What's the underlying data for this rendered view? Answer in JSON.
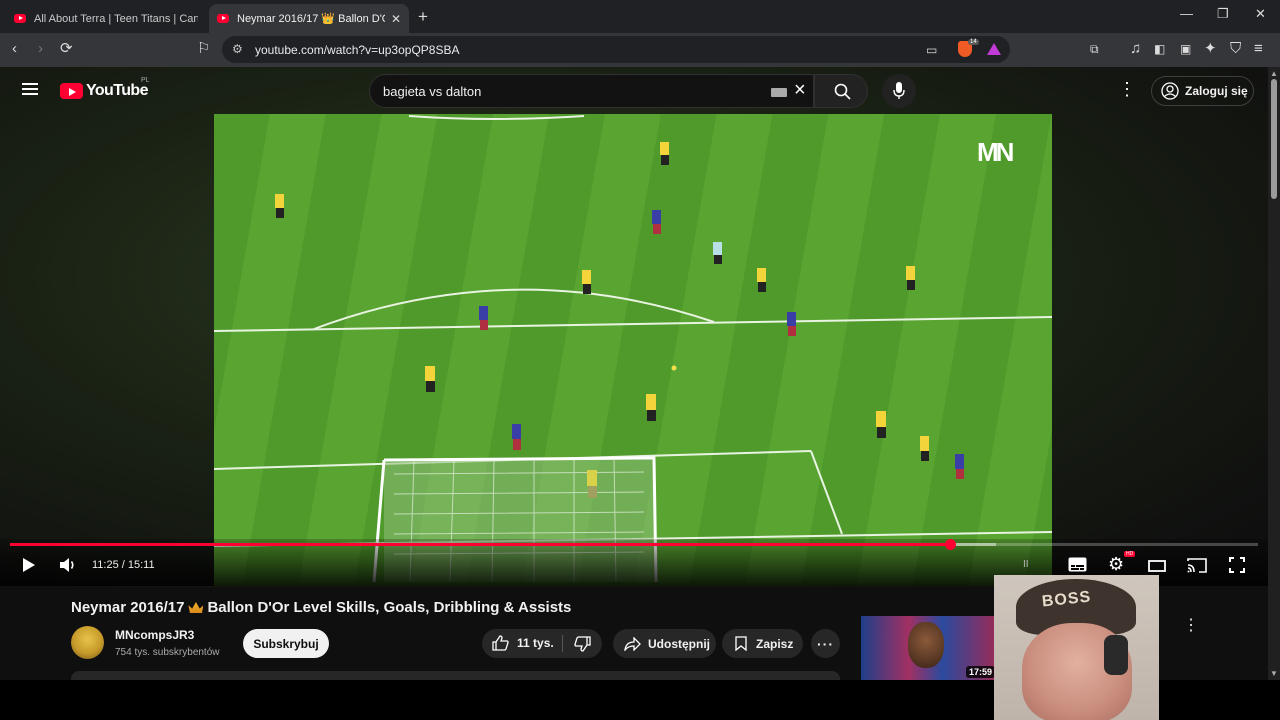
{
  "browser": {
    "tabs": [
      {
        "title": "All About Terra | Teen Titans | Cartoon"
      },
      {
        "title": "Neymar 2016/17 👑 Ballon D'Or"
      }
    ],
    "url": "youtube.com/watch?v=up3opQP8SBA",
    "brave_shield_count": "14"
  },
  "youtube": {
    "logo_text": "YouTube",
    "country_code": "PL",
    "search_value": "bagieta vs dalton",
    "signin_label": "Zaloguj się"
  },
  "player": {
    "current_time": "11:25",
    "duration": "15:11",
    "time_display": "11:25 / 15:11",
    "progress_fraction": 0.7533,
    "loaded_fraction": 0.79,
    "watermark": "MN",
    "hd_badge": "HD"
  },
  "video": {
    "title_part1": "Neymar 2016/17",
    "title_part2": "Ballon D'Or Level Skills, Goals, Dribbling & Assists",
    "channel_name": "MNcompsJR3",
    "subscribers": "754 tys. subskrybentów",
    "subscribe_label": "Subskrybuj",
    "likes": "11 tys.",
    "share_label": "Udostępnij",
    "save_label": "Zapisz"
  },
  "related": {
    "duration": "17:59"
  },
  "webcam": {
    "cap_text": "BOSS"
  },
  "colors": {
    "accent": "#ff0033",
    "background": "#0f0f0f",
    "pitch": "#5aa532",
    "keeper_kit": "#d8d24a",
    "away_kit": "#f3d43a",
    "home_kit": "#3a3fa8"
  }
}
